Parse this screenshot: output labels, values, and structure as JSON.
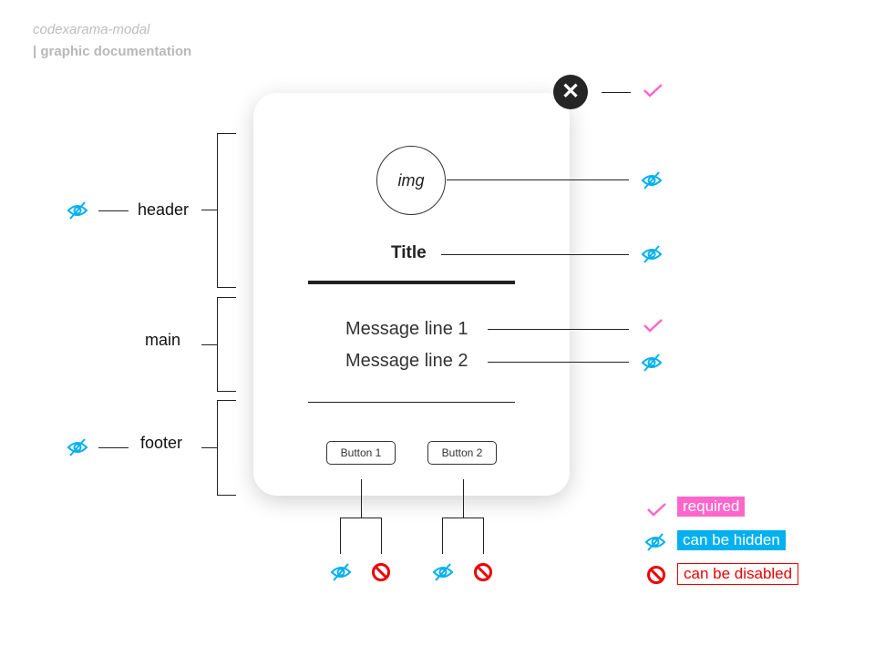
{
  "brand": {
    "name": "codexarama-modal",
    "subtitle": "| graphic documentation"
  },
  "modal": {
    "close_icon": "close-icon",
    "image_label": "img",
    "title": "Title",
    "messages": [
      "Message line 1",
      "Message line 2"
    ],
    "buttons": [
      "Button 1",
      "Button 2"
    ]
  },
  "sections": [
    "header",
    "main",
    "footer"
  ],
  "legend": [
    {
      "icon": "check-icon",
      "label": "required",
      "color": "#ff66cc"
    },
    {
      "icon": "eye-slash-icon",
      "label": "can be hidden",
      "color": "#00b0f0"
    },
    {
      "icon": "ban-icon",
      "label": "can be disabled",
      "color": "#ff0000"
    }
  ]
}
